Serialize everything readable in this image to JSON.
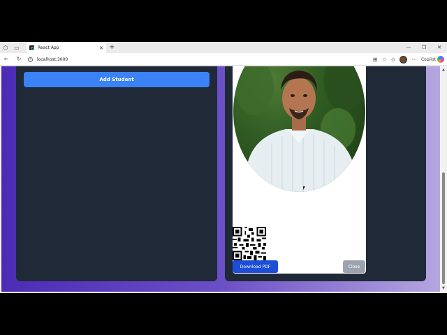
{
  "browser": {
    "tab_title": "React App",
    "tab_close": "✕",
    "new_tab": "+",
    "url": "localhost:3000",
    "copilot_label": "Copilot",
    "window_controls": {
      "minimize": "—",
      "restore": "❐",
      "close": "✕"
    }
  },
  "form": {
    "add_student_label": "Add Student"
  },
  "id_card": {
    "download_pdf_label": "Download PDF",
    "close_label": "Close"
  },
  "colors": {
    "primary_button": "#3b82f6",
    "download_button": "#1d4ed8",
    "close_button": "#9ca3af",
    "panel_bg": "#1f2937"
  }
}
